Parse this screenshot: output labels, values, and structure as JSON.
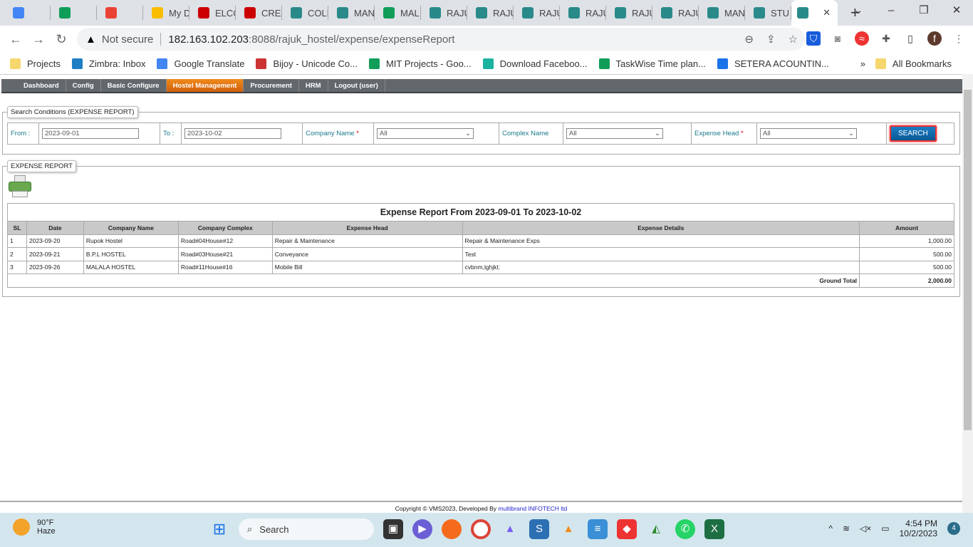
{
  "browser": {
    "tabs": [
      {
        "icon": "google-translate-icon",
        "title": "",
        "color": "#4285f4"
      },
      {
        "icon": "sheets-icon",
        "title": "",
        "color": "#0f9d58"
      },
      {
        "icon": "gmail-icon",
        "title": "",
        "color": "#ea4335"
      },
      {
        "icon": "drive-icon",
        "title": "My D",
        "color": "#fbbc04"
      },
      {
        "icon": "site-icon",
        "title": "ELCC",
        "color": "#c00"
      },
      {
        "icon": "site-icon",
        "title": "CREA",
        "color": "#c00"
      },
      {
        "icon": "exit-door-icon",
        "title": "COLL",
        "color": "#2a8a8a"
      },
      {
        "icon": "exit-door-icon",
        "title": "MAN",
        "color": "#2a8a8a"
      },
      {
        "icon": "sheets-icon",
        "title": "MAL",
        "color": "#0f9d58"
      },
      {
        "icon": "exit-door-icon",
        "title": "RAJU",
        "color": "#2a8a8a"
      },
      {
        "icon": "exit-door-icon",
        "title": "RAJU",
        "color": "#2a8a8a"
      },
      {
        "icon": "exit-door-icon",
        "title": "RAJU",
        "color": "#2a8a8a"
      },
      {
        "icon": "exit-door-icon",
        "title": "RAJU",
        "color": "#2a8a8a"
      },
      {
        "icon": "exit-door-icon",
        "title": "RAJU",
        "color": "#2a8a8a"
      },
      {
        "icon": "exit-door-icon",
        "title": "RAJU",
        "color": "#2a8a8a"
      },
      {
        "icon": "exit-door-icon",
        "title": "MAN",
        "color": "#2a8a8a"
      },
      {
        "icon": "exit-door-icon",
        "title": "STU",
        "color": "#2a8a8a"
      }
    ],
    "not_secure": "Not secure",
    "url_host": "182.163.102.203",
    "url_path": ":8088/rajuk_hostel/expense/expenseReport",
    "profile_initial": "f",
    "bookmarks": [
      {
        "label": "Projects",
        "color": "#f5d76e"
      },
      {
        "label": "Zimbra: Inbox",
        "color": "#1f7fc4"
      },
      {
        "label": "Google Translate",
        "color": "#4285f4"
      },
      {
        "label": "Bijoy - Unicode Co...",
        "color": "#c33"
      },
      {
        "label": "MIT Projects - Goo...",
        "color": "#0f9d58"
      },
      {
        "label": "Download Faceboo...",
        "color": "#1bb3a0"
      },
      {
        "label": "TaskWise Time plan...",
        "color": "#0f9d58"
      },
      {
        "label": "SETERA ACOUNTIN...",
        "color": "#1a73e8"
      }
    ],
    "all_bookmarks": "All Bookmarks"
  },
  "menu": [
    "Dashboard",
    "Config",
    "Basic Configure",
    "Hostel Management",
    "Procurement",
    "HRM",
    "Logout (user)"
  ],
  "menu_active": 3,
  "search": {
    "legend": "Search Conditions (EXPENSE REPORT)",
    "from_label": "From :",
    "from_value": "2023-09-01",
    "to_label": "To :",
    "to_value": "2023-10-02",
    "company_label": "Company Name",
    "company_value": "All",
    "complex_label": "Complex Name",
    "complex_value": "All",
    "head_label": "Expense Head",
    "head_value": "All",
    "required": "*",
    "button": "SEARCH"
  },
  "report": {
    "legend": "EXPENSE REPORT",
    "title": "Expense Report From 2023-09-01 To 2023-10-02",
    "columns": [
      "SL",
      "Date",
      "Company Name",
      "Company Complex",
      "Expense Head",
      "Expense Details",
      "Amount"
    ],
    "rows": [
      [
        "1",
        "2023-09-20",
        "Rupok Hostel",
        "Road#04House#12",
        "Repair & Maintenance",
        "Repair & Maintenance Exps",
        "1,000.00"
      ],
      [
        "2",
        "2023-09-21",
        "B.P.L HOSTEL",
        "Road#03House#21",
        "Conveyance",
        "Test",
        "500.00"
      ],
      [
        "3",
        "2023-09-26",
        "MALALA HOSTEL",
        "Road#11House#16",
        "Mobile Bill",
        "cvbnm,lghjkl;",
        "500.00"
      ]
    ],
    "total_label": "Ground Total",
    "total_value": "2,000.00"
  },
  "footer": {
    "text": "Copyright © VMS2023, Developed By ",
    "company": "multibrand INFOTECH ltd"
  },
  "taskbar": {
    "temp": "90°F",
    "weather": "Haze",
    "search": "Search",
    "time": "4:54 PM",
    "date": "10/2/2023",
    "badge": "4"
  }
}
